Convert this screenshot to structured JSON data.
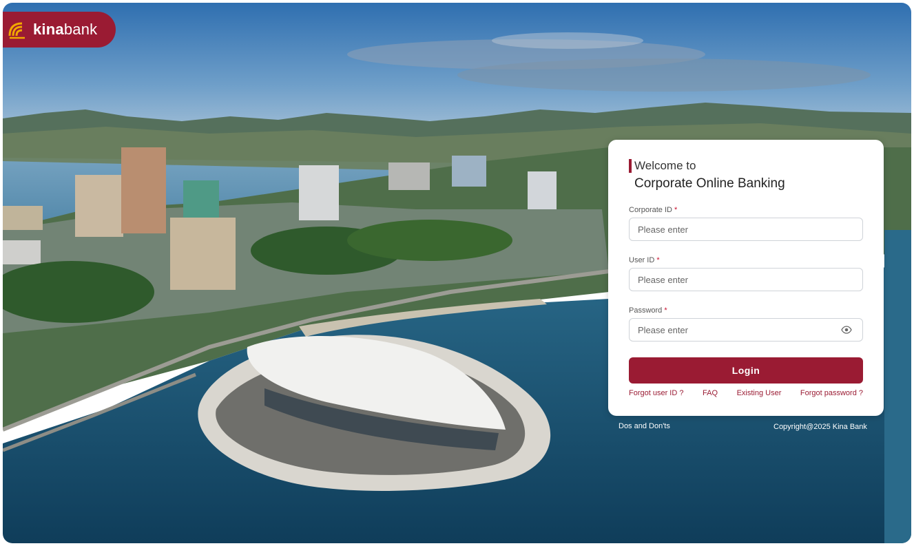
{
  "brand": {
    "name_bold": "kina",
    "name_light": "bank",
    "color": "#9a1b33"
  },
  "login": {
    "welcome_line1": "Welcome to",
    "welcome_line2": "Corporate Online Banking",
    "fields": [
      {
        "label": "Corporate ID",
        "required": "*",
        "placeholder": "Please enter"
      },
      {
        "label": "User ID",
        "required": "*",
        "placeholder": "Please enter"
      },
      {
        "label": "Password",
        "required": "*",
        "placeholder": "Please enter",
        "icon": "eye-icon"
      }
    ],
    "button_label": "Login",
    "links": [
      "Forgot user ID ?",
      "FAQ",
      "Existing User",
      "Forgot password ?"
    ]
  },
  "footer": {
    "left": "Dos and Don'ts",
    "right": "Copyright@2025 Kina Bank"
  }
}
